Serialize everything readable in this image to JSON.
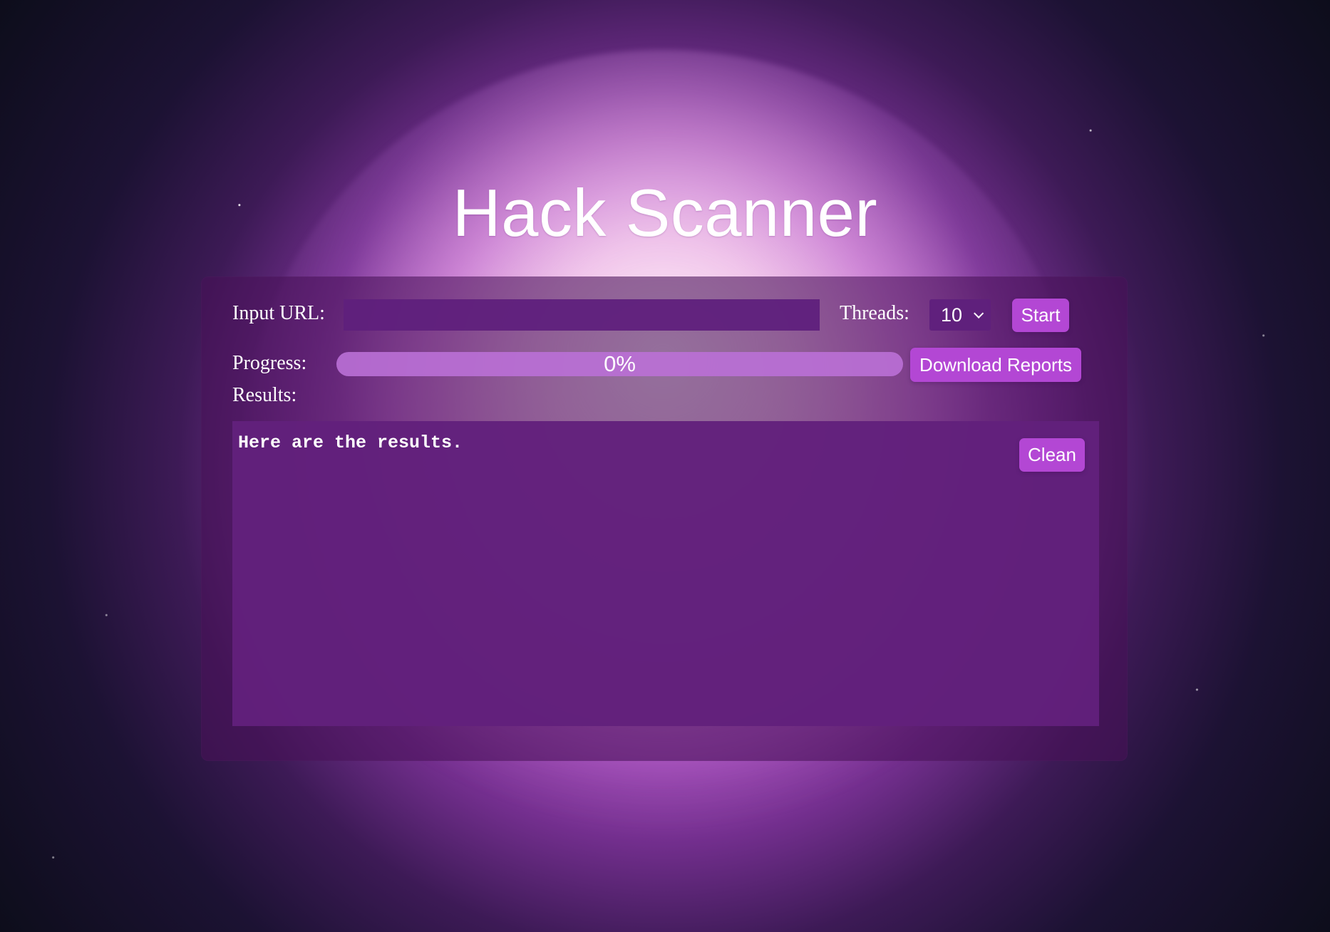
{
  "page": {
    "title": "Hack Scanner"
  },
  "scanner": {
    "input_url_label": "Input URL:",
    "input_url_value": "",
    "threads_label": "Threads:",
    "threads_value": "10",
    "start_label": "Start",
    "progress_label": "Progress:",
    "progress_percent": 0,
    "progress_text": "0%",
    "download_reports_label": "Download Reports",
    "results_label": "Results:",
    "results_text": "Here are the results.",
    "clean_label": "Clean"
  },
  "colors": {
    "accent_button": "#b347d4",
    "panel_purple": "#481258",
    "field_purple": "#5f207c",
    "text_white": "#ffffff"
  },
  "icons": {
    "threads_dropdown": "chevron-down-icon"
  }
}
